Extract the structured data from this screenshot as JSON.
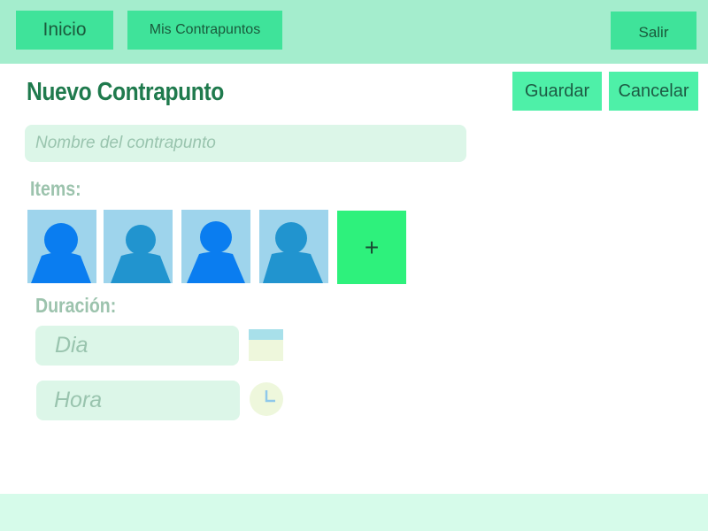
{
  "nav": {
    "inicio_label": "Inicio",
    "mis_contrapuntos_label": "Mis Contrapuntos",
    "salir_label": "Salir"
  },
  "page": {
    "title": "Nuevo Contrapunto"
  },
  "actions": {
    "guardar_label": "Guardar",
    "cancelar_label": "Cancelar"
  },
  "form": {
    "name_placeholder": "Nombre del contrapunto",
    "items_label": "Items:",
    "add_item_label": "+",
    "duracion_label": "Duración:",
    "dia_placeholder": "Dia",
    "hora_placeholder": "Hora"
  },
  "items": [
    {
      "icon": "user-avatar-icon",
      "color": "#0a7df0"
    },
    {
      "icon": "user-avatar-icon",
      "color": "#2194cf"
    },
    {
      "icon": "user-avatar-icon",
      "color": "#0a7df0"
    },
    {
      "icon": "user-avatar-icon",
      "color": "#2194cf"
    }
  ],
  "colors": {
    "accent": "#3fe39a",
    "title": "#1f7a4d",
    "add_button": "#2ef17c",
    "topbar": "#a4edcd"
  }
}
